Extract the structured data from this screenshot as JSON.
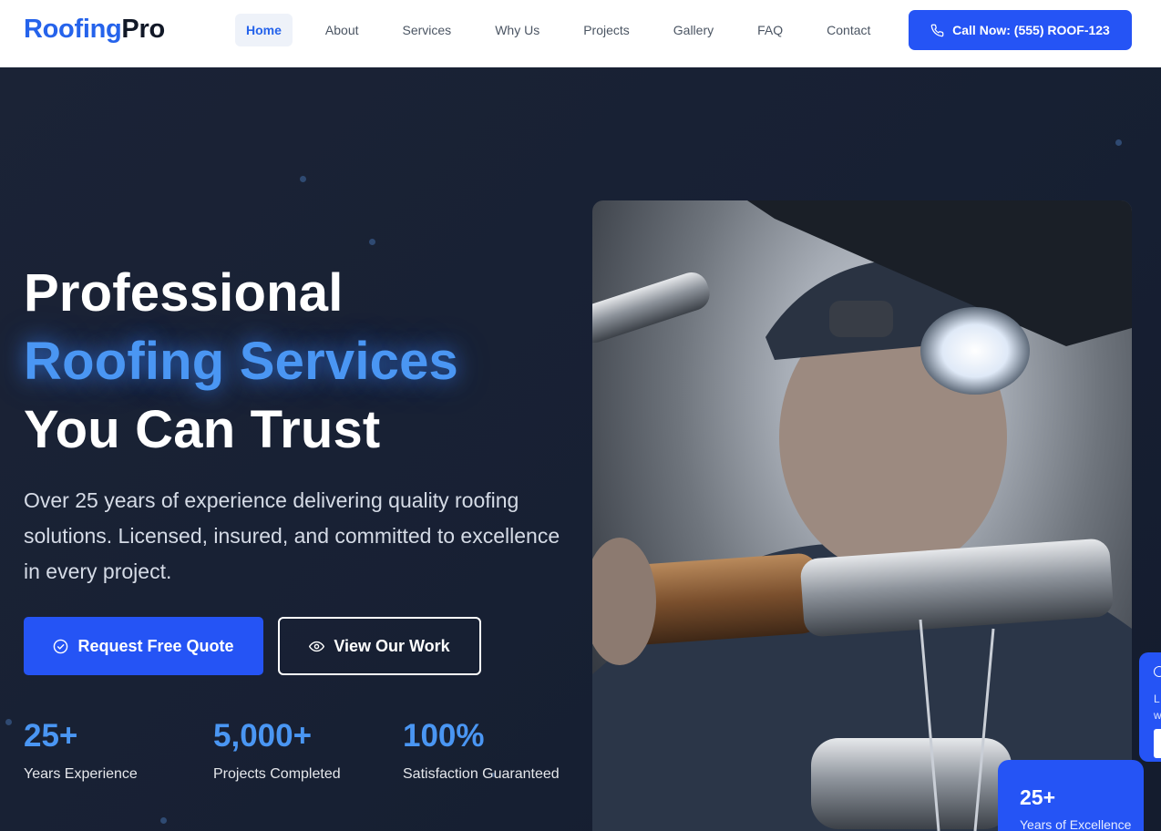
{
  "brand": {
    "part1": "Roofing",
    "part2": "Pro"
  },
  "nav": {
    "items": [
      {
        "label": "Home",
        "active": true
      },
      {
        "label": "About"
      },
      {
        "label": "Services"
      },
      {
        "label": "Why Us"
      },
      {
        "label": "Projects"
      },
      {
        "label": "Gallery"
      },
      {
        "label": "FAQ"
      },
      {
        "label": "Contact"
      }
    ],
    "call_label": "Call Now: (555) ROOF-123",
    "call_icon": "phone-icon"
  },
  "hero": {
    "headline_line1": "Professional",
    "headline_accent": "Roofing Services",
    "headline_line3": "You Can Trust",
    "subtitle": "Over 25 years of experience delivering quality roofing solutions. Licensed, insured, and committed to excellence in every project.",
    "primary_button": {
      "label": "Request Free Quote",
      "icon": "check-circle-icon"
    },
    "secondary_button": {
      "label": "View Our Work",
      "icon": "eye-icon"
    },
    "stats": [
      {
        "value": "25+",
        "label": "Years Experience"
      },
      {
        "value": "5,000+",
        "label": "Projects Completed"
      },
      {
        "value": "100%",
        "label": "Satisfaction Guaranteed"
      }
    ]
  },
  "badge": {
    "value": "25+",
    "label": "Years of Excellence"
  },
  "side_card": {
    "line1": "L",
    "line2": "w"
  },
  "colors": {
    "accent": "#2554f5",
    "accent_light": "#4a96f3",
    "hero_bg": "#1b2336"
  }
}
